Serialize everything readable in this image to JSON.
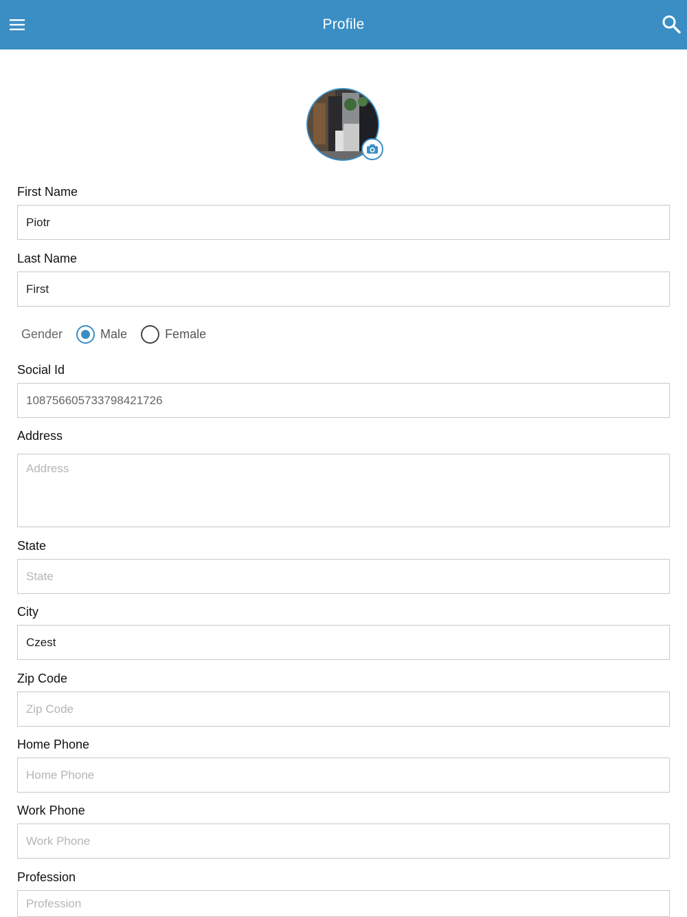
{
  "header": {
    "title": "Profile",
    "menu_icon": "hamburger-menu-icon",
    "search_icon": "search-icon",
    "color": "#3a8ec4"
  },
  "avatar": {
    "camera_icon": "camera-icon"
  },
  "form": {
    "first_name": {
      "label": "First Name",
      "value": "Piotr"
    },
    "last_name": {
      "label": "Last Name",
      "value": "First"
    },
    "gender": {
      "label": "Gender",
      "options": [
        "Male",
        "Female"
      ],
      "selected": "Male"
    },
    "social_id": {
      "label": "Social Id",
      "value": "108756605733798421726"
    },
    "address": {
      "label": "Address",
      "value": "",
      "placeholder": "Address"
    },
    "state": {
      "label": "State",
      "value": "",
      "placeholder": "State"
    },
    "city": {
      "label": "City",
      "value": "Czest"
    },
    "zip_code": {
      "label": "Zip Code",
      "value": "",
      "placeholder": "Zip Code"
    },
    "home_phone": {
      "label": "Home Phone",
      "value": "",
      "placeholder": "Home Phone"
    },
    "work_phone": {
      "label": "Work Phone",
      "value": "",
      "placeholder": "Work Phone"
    },
    "profession": {
      "label": "Profession",
      "value": "",
      "placeholder": "Profession"
    }
  }
}
